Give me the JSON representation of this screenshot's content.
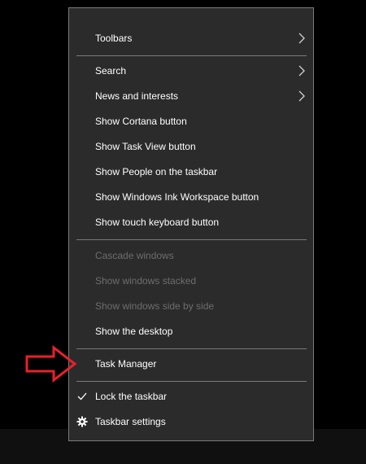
{
  "context_menu": {
    "items": {
      "toolbars": "Toolbars",
      "search": "Search",
      "news_and_interests": "News and interests",
      "show_cortana_button": "Show Cortana button",
      "show_task_view_button": "Show Task View button",
      "show_people_on_taskbar": "Show People on the taskbar",
      "show_windows_ink_workspace_button": "Show Windows Ink Workspace button",
      "show_touch_keyboard_button": "Show touch keyboard button",
      "cascade_windows": "Cascade windows",
      "show_windows_stacked": "Show windows stacked",
      "show_windows_side_by_side": "Show windows side by side",
      "show_the_desktop": "Show the desktop",
      "task_manager": "Task Manager",
      "lock_the_taskbar": "Lock the taskbar",
      "taskbar_settings": "Taskbar settings"
    },
    "disabled_items": [
      "Cascade windows",
      "Show windows stacked",
      "Show windows side by side"
    ],
    "checked_items": [
      "Lock the taskbar"
    ],
    "submenu_items": [
      "Toolbars",
      "Search",
      "News and interests"
    ]
  },
  "annotation": {
    "icon": "red-outline-arrow-icon",
    "points_to": "Task Manager",
    "color": "#e8202a"
  },
  "colors": {
    "menu_background": "#2b2b2b",
    "menu_border": "#7a7a7a",
    "text": "#ffffff",
    "disabled_text": "#6d6d6d",
    "screen_background": "#000000",
    "taskbar_background": "#101010"
  }
}
